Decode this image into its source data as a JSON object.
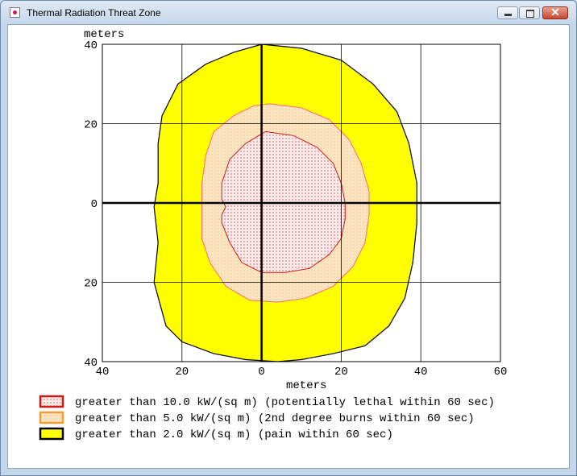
{
  "window": {
    "title": "Thermal Radiation Threat Zone",
    "icons": {
      "app": "app-icon",
      "minimize": "minimize-icon",
      "maximize": "maximize-icon",
      "close": "close-icon"
    }
  },
  "chart_data": {
    "type": "area",
    "unit_label_y": "meters",
    "xlabel": "meters",
    "x_ticks": [
      "40",
      "20",
      "0",
      "20",
      "40",
      "60"
    ],
    "y_ticks": [
      "40",
      "20",
      "0",
      "20",
      "40"
    ],
    "xlim": [
      -40,
      60
    ],
    "ylim": [
      -40,
      40
    ],
    "grid": true,
    "legend_position": "bottom",
    "series": [
      {
        "name": "greater than 2.0 kW/(sq m)  (pain within 60 sec)",
        "color": "#ffff00",
        "outline": "#000000",
        "points": [
          [
            0,
            40
          ],
          [
            10,
            39
          ],
          [
            20,
            36
          ],
          [
            28,
            30
          ],
          [
            34,
            23
          ],
          [
            37,
            15
          ],
          [
            39,
            5
          ],
          [
            39,
            0
          ],
          [
            39,
            -5
          ],
          [
            38,
            -15
          ],
          [
            36,
            -24
          ],
          [
            32,
            -31
          ],
          [
            26,
            -36
          ],
          [
            18,
            -38
          ],
          [
            10,
            -39.5
          ],
          [
            4,
            -40
          ],
          [
            -4,
            -39.5
          ],
          [
            -12,
            -38
          ],
          [
            -20,
            -35
          ],
          [
            -24,
            -31
          ],
          [
            -27,
            -20
          ],
          [
            -26,
            -10
          ],
          [
            -27,
            -1
          ],
          [
            -26,
            5
          ],
          [
            -26,
            15
          ],
          [
            -25,
            22
          ],
          [
            -21,
            30
          ],
          [
            -14,
            35
          ],
          [
            -7,
            38
          ],
          [
            0,
            40
          ]
        ]
      },
      {
        "name": "greater than 5.0 kW/(sq m)  (2nd degree burns within 60 sec)",
        "color": "#fde5c2",
        "outline": "#ff6a6a",
        "points": [
          [
            2,
            25
          ],
          [
            10,
            24
          ],
          [
            17,
            21
          ],
          [
            22,
            16
          ],
          [
            25,
            10
          ],
          [
            27,
            3
          ],
          [
            27,
            -3
          ],
          [
            26,
            -10
          ],
          [
            23,
            -16
          ],
          [
            18,
            -21
          ],
          [
            11,
            -24
          ],
          [
            4,
            -25
          ],
          [
            -3,
            -24.5
          ],
          [
            -9,
            -21
          ],
          [
            -13,
            -15
          ],
          [
            -15,
            -9
          ],
          [
            -15,
            -2
          ],
          [
            -15,
            5
          ],
          [
            -14,
            12
          ],
          [
            -12,
            18
          ],
          [
            -7,
            22
          ],
          [
            -2,
            24.5
          ],
          [
            2,
            25
          ]
        ]
      },
      {
        "name": "greater than 10.0 kW/(sq m)  (potentially lethal within 60 sec)",
        "color": "#fbeaea",
        "outline": "#d01818",
        "points": [
          [
            1,
            18
          ],
          [
            8,
            17
          ],
          [
            14,
            14
          ],
          [
            18,
            10
          ],
          [
            20,
            5
          ],
          [
            21,
            0
          ],
          [
            21,
            -4
          ],
          [
            20,
            -9
          ],
          [
            17,
            -13
          ],
          [
            12,
            -16.5
          ],
          [
            6,
            -17.5
          ],
          [
            0,
            -17.5
          ],
          [
            -5,
            -15
          ],
          [
            -8,
            -10
          ],
          [
            -10,
            -5
          ],
          [
            -10,
            -3
          ],
          [
            -9,
            -1
          ],
          [
            -10,
            1
          ],
          [
            -10,
            5
          ],
          [
            -8,
            11
          ],
          [
            -4,
            15
          ],
          [
            1,
            18
          ]
        ]
      }
    ],
    "legend": [
      {
        "label": "greater than 10.0 kW/(sq m)  (potentially lethal within 60 sec)",
        "fill": "#fbeaea",
        "border": "#d01818"
      },
      {
        "label": "greater than 5.0 kW/(sq m)  (2nd degree burns within 60 sec)",
        "fill": "#fde5c2",
        "border": "#f39c39"
      },
      {
        "label": "greater than 2.0 kW/(sq m)  (pain within 60 sec)",
        "fill": "#ffff00",
        "border": "#000000"
      }
    ]
  }
}
